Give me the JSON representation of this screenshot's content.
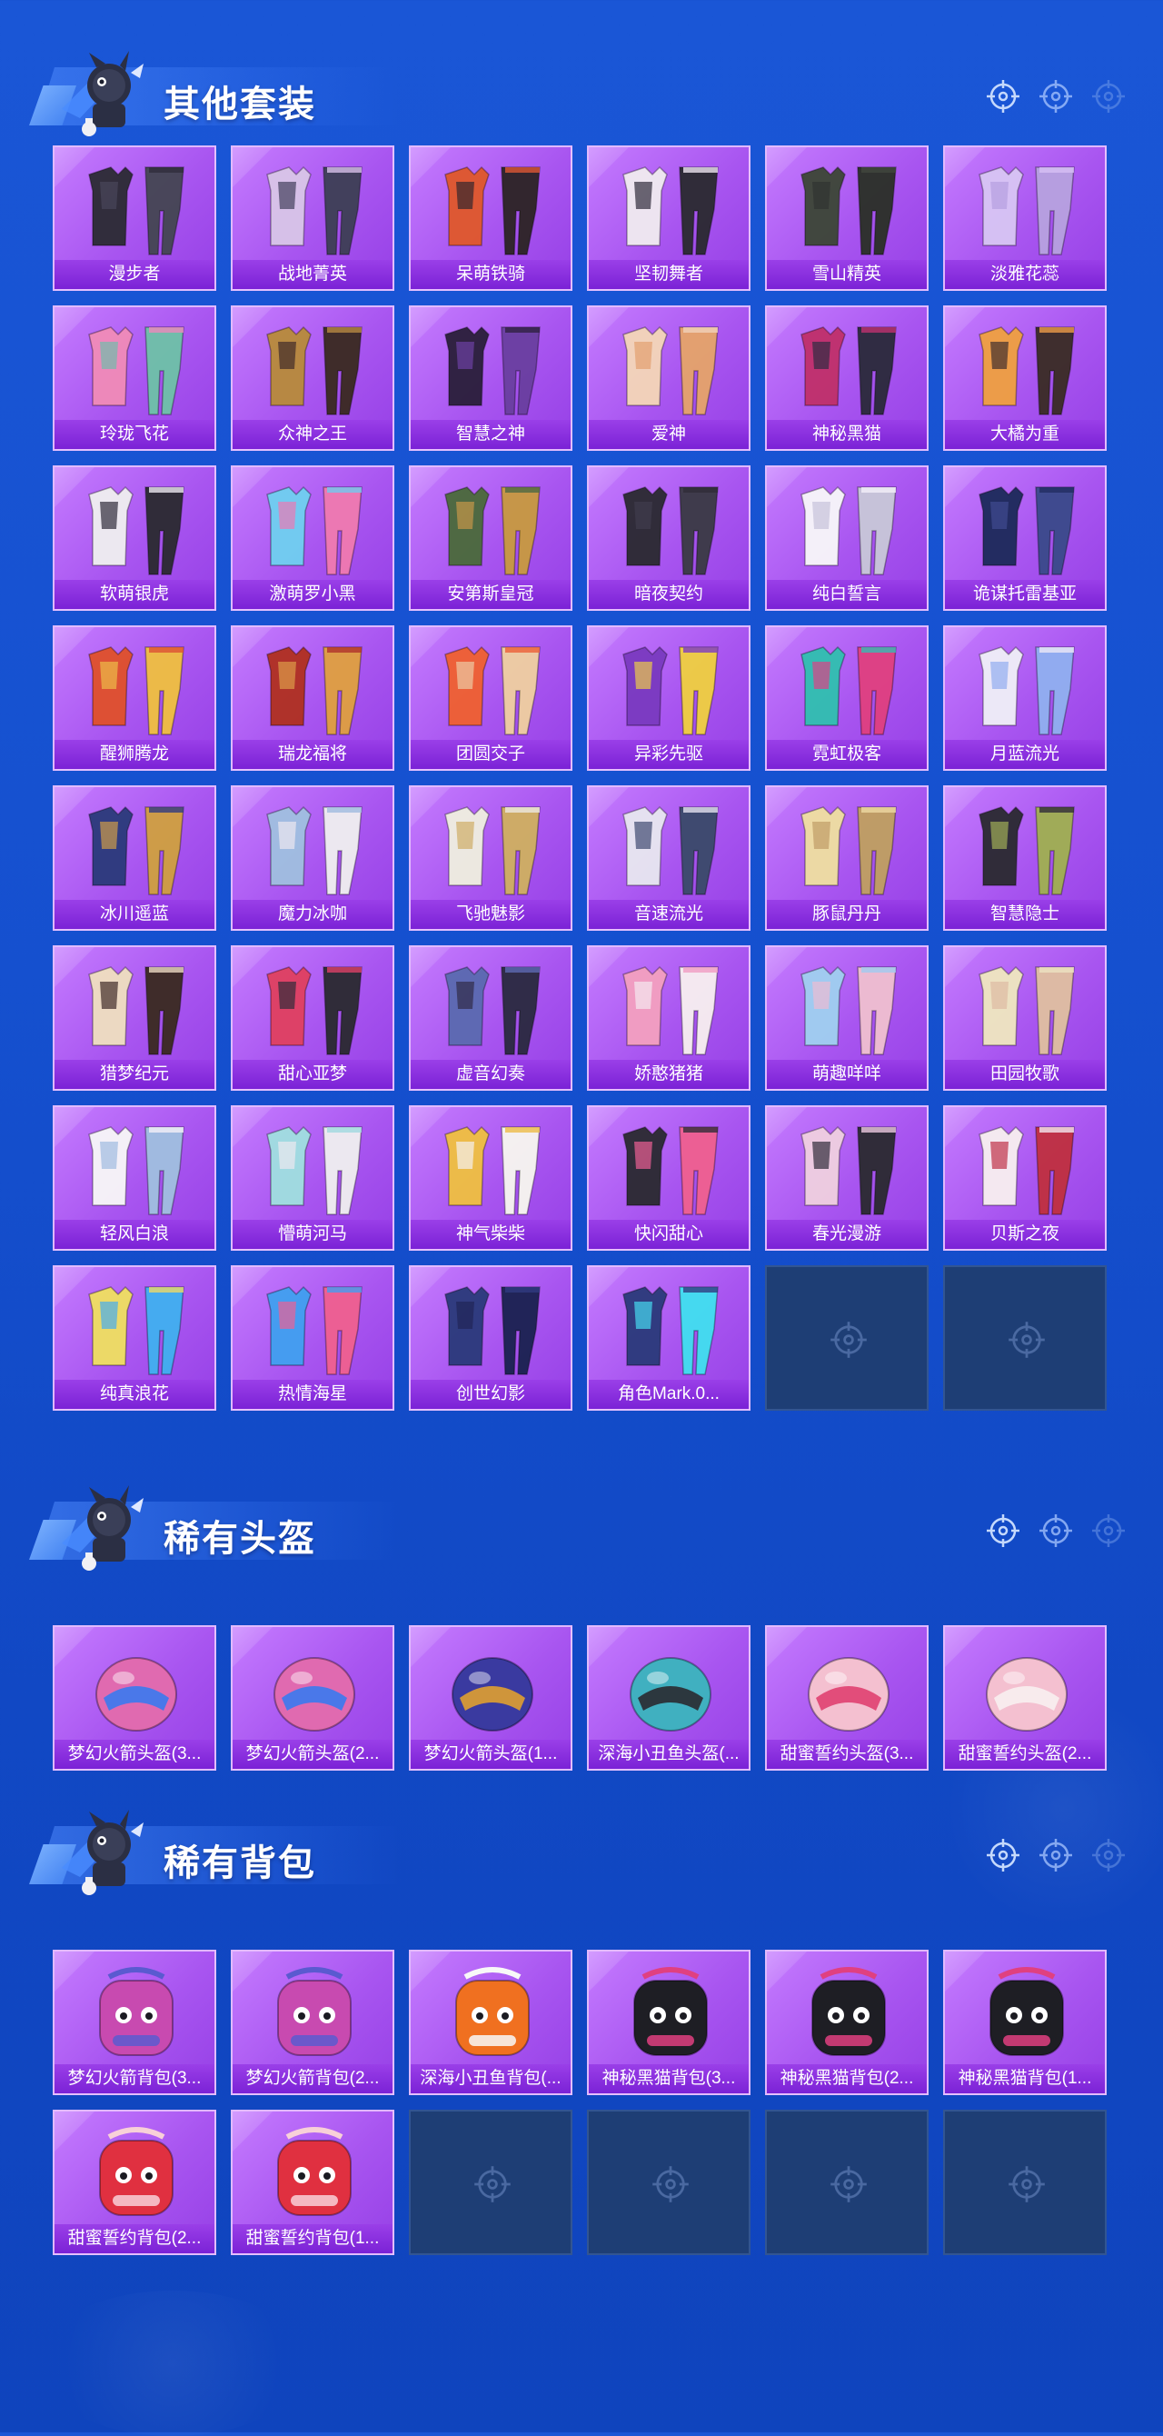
{
  "colors": {
    "background": "#1550cf",
    "card_purple": "#a855f0",
    "label_purple": "#7b22d6",
    "empty_slot": "#1e3e75"
  },
  "sections": [
    {
      "title": "其他套装",
      "icon": "mascot-icon",
      "items": [
        {
          "name": "漫步者",
          "icon": "outfit-icon"
        },
        {
          "name": "战地菁英",
          "icon": "outfit-icon"
        },
        {
          "name": "呆萌铁骑",
          "icon": "outfit-icon"
        },
        {
          "name": "坚韧舞者",
          "icon": "outfit-icon"
        },
        {
          "name": "雪山精英",
          "icon": "outfit-icon"
        },
        {
          "name": "淡雅花蕊",
          "icon": "outfit-icon"
        },
        {
          "name": "玲珑飞花",
          "icon": "outfit-icon"
        },
        {
          "name": "众神之王",
          "icon": "outfit-icon"
        },
        {
          "name": "智慧之神",
          "icon": "outfit-icon"
        },
        {
          "name": "爱神",
          "icon": "outfit-icon"
        },
        {
          "name": "神秘黑猫",
          "icon": "outfit-icon"
        },
        {
          "name": "大橘为重",
          "icon": "outfit-icon"
        },
        {
          "name": "软萌银虎",
          "icon": "outfit-icon"
        },
        {
          "name": "激萌罗小黑",
          "icon": "outfit-icon"
        },
        {
          "name": "安第斯皇冠",
          "icon": "outfit-icon"
        },
        {
          "name": "暗夜契约",
          "icon": "outfit-icon"
        },
        {
          "name": "纯白誓言",
          "icon": "outfit-icon"
        },
        {
          "name": "诡谋托雷基亚",
          "icon": "outfit-icon"
        },
        {
          "name": "醒狮腾龙",
          "icon": "outfit-icon"
        },
        {
          "name": "瑞龙福将",
          "icon": "outfit-icon"
        },
        {
          "name": "团圆交子",
          "icon": "outfit-icon"
        },
        {
          "name": "异彩先驱",
          "icon": "outfit-icon"
        },
        {
          "name": "霓虹极客",
          "icon": "outfit-icon"
        },
        {
          "name": "月蓝流光",
          "icon": "outfit-icon"
        },
        {
          "name": "冰川遥蓝",
          "icon": "outfit-icon"
        },
        {
          "name": "魔力冰咖",
          "icon": "outfit-icon"
        },
        {
          "name": "飞驰魅影",
          "icon": "outfit-icon"
        },
        {
          "name": "音速流光",
          "icon": "outfit-icon"
        },
        {
          "name": "豚鼠丹丹",
          "icon": "outfit-icon"
        },
        {
          "name": "智慧隐士",
          "icon": "outfit-icon"
        },
        {
          "name": "猎梦纪元",
          "icon": "outfit-icon"
        },
        {
          "name": "甜心亚梦",
          "icon": "outfit-icon"
        },
        {
          "name": "虚音幻奏",
          "icon": "outfit-icon"
        },
        {
          "name": "娇憨猪猪",
          "icon": "outfit-icon"
        },
        {
          "name": "萌趣咩咩",
          "icon": "outfit-icon"
        },
        {
          "name": "田园牧歌",
          "icon": "outfit-icon"
        },
        {
          "name": "轻风白浪",
          "icon": "outfit-icon"
        },
        {
          "name": "懵萌河马",
          "icon": "outfit-icon"
        },
        {
          "name": "神气柴柴",
          "icon": "outfit-icon"
        },
        {
          "name": "快闪甜心",
          "icon": "outfit-icon"
        },
        {
          "name": "春光漫游",
          "icon": "outfit-icon"
        },
        {
          "name": "贝斯之夜",
          "icon": "outfit-icon"
        },
        {
          "name": "纯真浪花",
          "icon": "outfit-icon"
        },
        {
          "name": "热情海星",
          "icon": "outfit-icon"
        },
        {
          "name": "创世幻影",
          "icon": "outfit-icon"
        },
        {
          "name": "角色Mark.0...",
          "icon": "outfit-icon"
        }
      ],
      "empty_slots": 2
    },
    {
      "title": "稀有头盔",
      "icon": "mascot-icon",
      "items": [
        {
          "name": "梦幻火箭头盔(3...",
          "icon": "helmet-icon"
        },
        {
          "name": "梦幻火箭头盔(2...",
          "icon": "helmet-icon"
        },
        {
          "name": "梦幻火箭头盔(1...",
          "icon": "helmet-icon"
        },
        {
          "name": "深海小丑鱼头盔(...",
          "icon": "helmet-icon"
        },
        {
          "name": "甜蜜誓约头盔(3...",
          "icon": "helmet-icon"
        },
        {
          "name": "甜蜜誓约头盔(2...",
          "icon": "helmet-icon"
        }
      ],
      "empty_slots": 0
    },
    {
      "title": "稀有背包",
      "icon": "mascot-icon",
      "items": [
        {
          "name": "梦幻火箭背包(3...",
          "icon": "backpack-icon"
        },
        {
          "name": "梦幻火箭背包(2...",
          "icon": "backpack-icon"
        },
        {
          "name": "深海小丑鱼背包(...",
          "icon": "backpack-icon"
        },
        {
          "name": "神秘黑猫背包(3...",
          "icon": "backpack-icon"
        },
        {
          "name": "神秘黑猫背包(2...",
          "icon": "backpack-icon"
        },
        {
          "name": "神秘黑猫背包(1...",
          "icon": "backpack-icon"
        },
        {
          "name": "甜蜜誓约背包(2...",
          "icon": "backpack-icon"
        },
        {
          "name": "甜蜜誓约背包(1...",
          "icon": "backpack-icon"
        }
      ],
      "empty_slots": 4
    }
  ]
}
